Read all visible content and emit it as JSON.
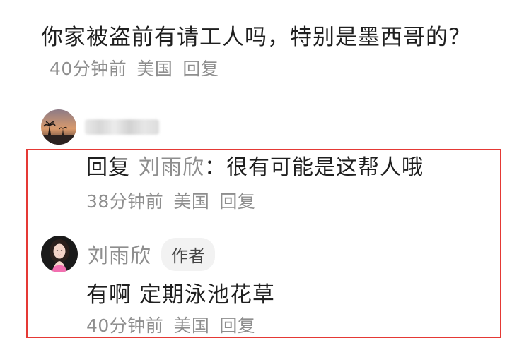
{
  "top_comment": {
    "text": "你家被盗前有请工人吗，特别是墨西哥的？",
    "time": "40分钟前",
    "location": "美国",
    "reply_label": "回复"
  },
  "reply": {
    "username_blurred": true,
    "prefix": "回复",
    "target_user": "刘雨欣",
    "body": "：很有可能是这帮人哦",
    "time": "38分钟前",
    "location": "美国",
    "reply_label": "回复"
  },
  "author_reply": {
    "username": "刘雨欣",
    "badge": "作者",
    "text": "有啊 定期泳池花草",
    "time": "40分钟前",
    "location": "美国",
    "reply_label": "回复"
  },
  "highlight_color": "#e53935"
}
